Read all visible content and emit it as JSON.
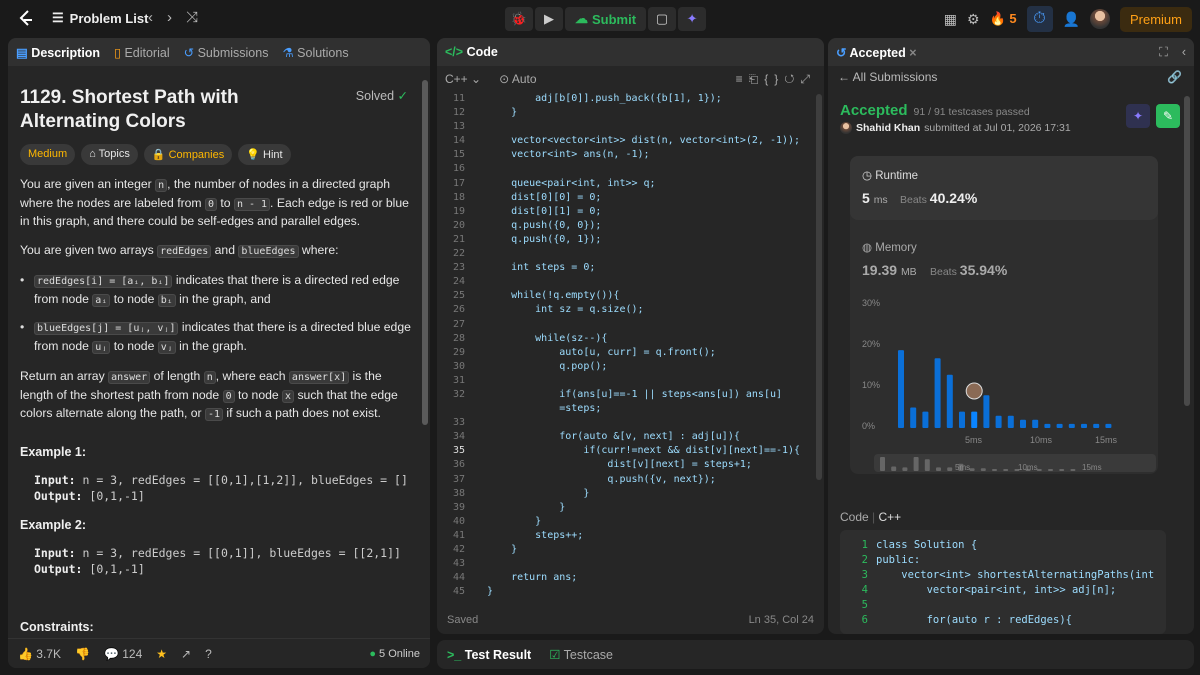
{
  "topbar": {
    "problem_list": "Problem List",
    "submit": "Submit",
    "streak": "5",
    "premium": "Premium"
  },
  "desc_tabs": [
    "Description",
    "Editorial",
    "Submissions",
    "Solutions"
  ],
  "problem": {
    "title": "1129. Shortest Path with Alternating Colors",
    "solved": "Solved",
    "tags": [
      "Medium",
      "Topics",
      "Companies",
      "Hint"
    ],
    "p1": "You are given an integer ",
    "p1_n": "n",
    "p1b": ", the number of nodes in a directed graph where the nodes are labeled from ",
    "p1_0": "0",
    "p1c": " to ",
    "p1_n1": "n - 1",
    "p1d": ". Each edge is red or blue in this graph, and there could be self-edges and parallel edges.",
    "p2a": "You are given two arrays ",
    "p2_re": "redEdges",
    "p2b": " and ",
    "p2_be": "blueEdges",
    "p2c": " where:",
    "b1_code": "redEdges[i] = [aᵢ, bᵢ]",
    "b1_text": " indicates that there is a directed red edge from node ",
    "b1_a": "aᵢ",
    "b1_mid": " to node ",
    "b1_b": "bᵢ",
    "b1_end": " in the graph, and",
    "b2_code": "blueEdges[j] = [uⱼ, vⱼ]",
    "b2_text": " indicates that there is a directed blue edge from node ",
    "b2_u": "uⱼ",
    "b2_mid": " to node ",
    "b2_v": "vⱼ",
    "b2_end": " in the graph.",
    "p3a": "Return an array ",
    "p3_ans": "answer",
    "p3b": " of length ",
    "p3_n": "n",
    "p3c": ", where each ",
    "p3_ax": "answer[x]",
    "p3d": " is the length of the shortest path from node ",
    "p3_0": "0",
    "p3e": " to node ",
    "p3_x": "x",
    "p3f": " such that the edge colors alternate along the path, or ",
    "p3_m1": "-1",
    "p3g": " if such a path does not exist.",
    "ex1_h": "Example 1:",
    "ex1_in_l": "Input:",
    "ex1_in": " n = 3, redEdges = [[0,1],[1,2]], blueEdges = []",
    "ex1_out_l": "Output:",
    "ex1_out": " [0,1,-1]",
    "ex2_h": "Example 2:",
    "ex2_in_l": "Input:",
    "ex2_in": " n = 3, redEdges = [[0,1]], blueEdges = [[2,1]]",
    "ex2_out_l": "Output:",
    "ex2_out": " [0,1,-1]",
    "constraints": "Constraints:"
  },
  "desc_footer": {
    "likes": "3.7K",
    "comments": "124",
    "online": "5 Online"
  },
  "code_panel": {
    "title": "Code",
    "lang": "C++",
    "auto": "Auto",
    "saved": "Saved",
    "pos": "Ln 35, Col 24"
  },
  "code_lines": [
    {
      "n": "11",
      "t": "        adj[b[0]].push_back({b[1], 1});"
    },
    {
      "n": "12",
      "t": "    }"
    },
    {
      "n": "13",
      "t": ""
    },
    {
      "n": "14",
      "t": "    vector<vector<int>> dist(n, vector<int>(2, -1));"
    },
    {
      "n": "15",
      "t": "    vector<int> ans(n, -1);"
    },
    {
      "n": "16",
      "t": ""
    },
    {
      "n": "17",
      "t": "    queue<pair<int, int>> q;"
    },
    {
      "n": "18",
      "t": "    dist[0][0] = 0;"
    },
    {
      "n": "19",
      "t": "    dist[0][1] = 0;"
    },
    {
      "n": "20",
      "t": "    q.push({0, 0});"
    },
    {
      "n": "21",
      "t": "    q.push({0, 1});"
    },
    {
      "n": "22",
      "t": ""
    },
    {
      "n": "23",
      "t": "    int steps = 0;"
    },
    {
      "n": "24",
      "t": ""
    },
    {
      "n": "25",
      "t": "    while(!q.empty()){"
    },
    {
      "n": "26",
      "t": "        int sz = q.size();"
    },
    {
      "n": "27",
      "t": ""
    },
    {
      "n": "28",
      "t": "        while(sz--){"
    },
    {
      "n": "29",
      "t": "            auto[u, curr] = q.front();"
    },
    {
      "n": "30",
      "t": "            q.pop();"
    },
    {
      "n": "31",
      "t": ""
    },
    {
      "n": "32",
      "t": "            if(ans[u]==-1 || steps<ans[u]) ans[u]"
    },
    {
      "n": "",
      "t": "            =steps;"
    },
    {
      "n": "33",
      "t": ""
    },
    {
      "n": "34",
      "t": "            for(auto &[v, next] : adj[u]){"
    },
    {
      "n": "35",
      "t": "                if(curr!=next && dist[v][next]==-1){"
    },
    {
      "n": "36",
      "t": "                    dist[v][next] = steps+1;"
    },
    {
      "n": "37",
      "t": "                    q.push({v, next});"
    },
    {
      "n": "38",
      "t": "                }"
    },
    {
      "n": "39",
      "t": "            }"
    },
    {
      "n": "40",
      "t": "        }"
    },
    {
      "n": "41",
      "t": "        steps++;"
    },
    {
      "n": "42",
      "t": "    }"
    },
    {
      "n": "43",
      "t": ""
    },
    {
      "n": "44",
      "t": "    return ans;"
    },
    {
      "n": "45",
      "t": "}"
    }
  ],
  "accepted": {
    "tab": "Accepted",
    "all": "All Submissions",
    "status": "Accepted",
    "testcases": "91 / 91 testcases passed",
    "user": "Shahid Khan",
    "submitted": "submitted at Jul 01, 2026 17:31",
    "runtime_label": "Runtime",
    "runtime_val": "5",
    "runtime_unit": "ms",
    "runtime_beats_l": "Beats",
    "runtime_beats": "40.24%",
    "memory_label": "Memory",
    "memory_val": "19.39",
    "memory_unit": "MB",
    "memory_beats_l": "Beats",
    "memory_beats": "35.94%",
    "code_label": "Code",
    "code_lang": "C++"
  },
  "chart_data": {
    "type": "bar",
    "yticks": [
      "30%",
      "20%",
      "10%",
      "0%"
    ],
    "xticks": [
      "5ms",
      "10ms",
      "15ms"
    ],
    "values": [
      19,
      5,
      4,
      17,
      13,
      4,
      4,
      8,
      3,
      3,
      2,
      2,
      1,
      1,
      1,
      1,
      1,
      1
    ],
    "mini_xticks": [
      "5ms",
      "10ms",
      "15ms"
    ]
  },
  "code2_lines": [
    {
      "n": "1",
      "t": "class Solution {"
    },
    {
      "n": "2",
      "t": "public:"
    },
    {
      "n": "3",
      "t": "    vector<int> shortestAlternatingPaths(int"
    },
    {
      "n": "4",
      "t": "        vector<pair<int, int>> adj[n];"
    },
    {
      "n": "5",
      "t": ""
    },
    {
      "n": "6",
      "t": "        for(auto r : redEdges){"
    }
  ],
  "test": {
    "result": "Test Result",
    "testcase": "Testcase"
  },
  "colors": {
    "accent": "#2cbb5d",
    "brand": "#ffa116",
    "bar": "#0a84ff"
  }
}
